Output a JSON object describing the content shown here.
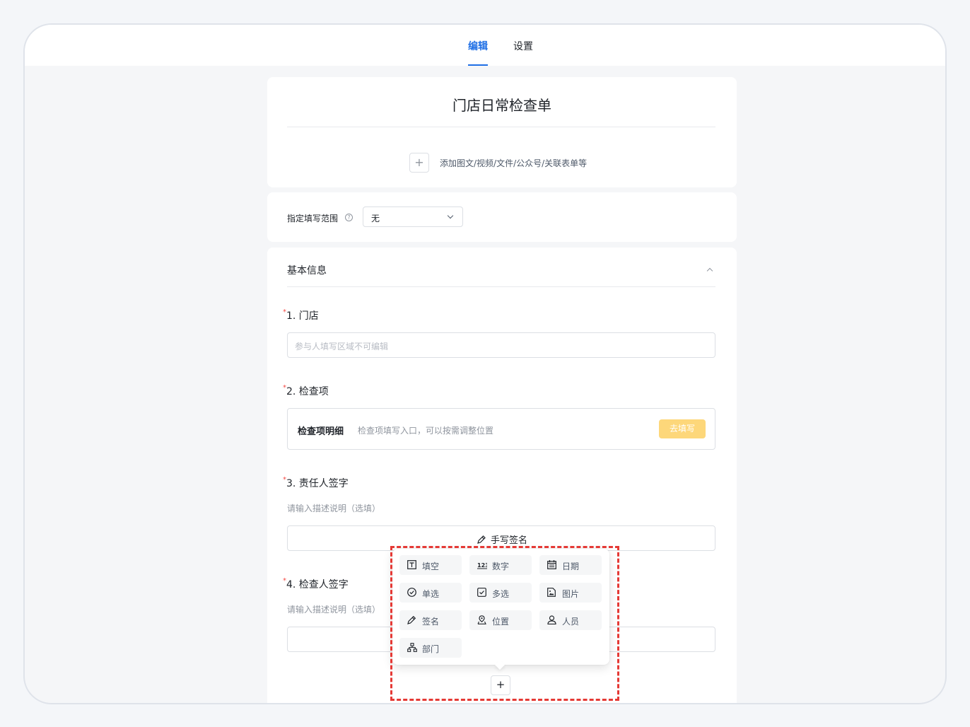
{
  "tabs": {
    "edit": "编辑",
    "settings": "设置"
  },
  "form": {
    "title": "门店日常检查单",
    "add_media_text": "添加图文/视频/文件/公众号/关联表单等"
  },
  "scope": {
    "label": "指定填写范围",
    "value": "无"
  },
  "section": {
    "title": "基本信息"
  },
  "questions": {
    "q1": {
      "required": "*",
      "label": "1. 门店",
      "placeholder": "参与人填写区域不可编辑"
    },
    "q2": {
      "required": "*",
      "label": "2. 检查项",
      "detail_title": "检查项明细",
      "detail_desc": "检查项填写入口，可以按需调整位置",
      "fill_button": "去填写"
    },
    "q3": {
      "required": "*",
      "label": "3. 责任人签字",
      "desc": "请输入描述说明（选填）",
      "sign_button": "手写签名"
    },
    "q4": {
      "required": "*",
      "label": "4. 检查人签字",
      "desc": "请输入描述说明（选填）"
    }
  },
  "field_menu": {
    "items": [
      {
        "label": "填空",
        "icon": "text-field-icon"
      },
      {
        "label": "数字",
        "icon": "number-icon"
      },
      {
        "label": "日期",
        "icon": "calendar-icon"
      },
      {
        "label": "单选",
        "icon": "radio-icon"
      },
      {
        "label": "多选",
        "icon": "checkbox-icon"
      },
      {
        "label": "图片",
        "icon": "image-file-icon"
      },
      {
        "label": "签名",
        "icon": "pen-icon"
      },
      {
        "label": "位置",
        "icon": "location-icon"
      },
      {
        "label": "人员",
        "icon": "person-icon"
      },
      {
        "label": "部门",
        "icon": "org-chart-icon"
      }
    ]
  },
  "add_button": "+",
  "colors": {
    "accent": "#1f6fe5",
    "required": "#f54a45",
    "fill_button": "#fdd77a",
    "highlight": "#e53935"
  }
}
